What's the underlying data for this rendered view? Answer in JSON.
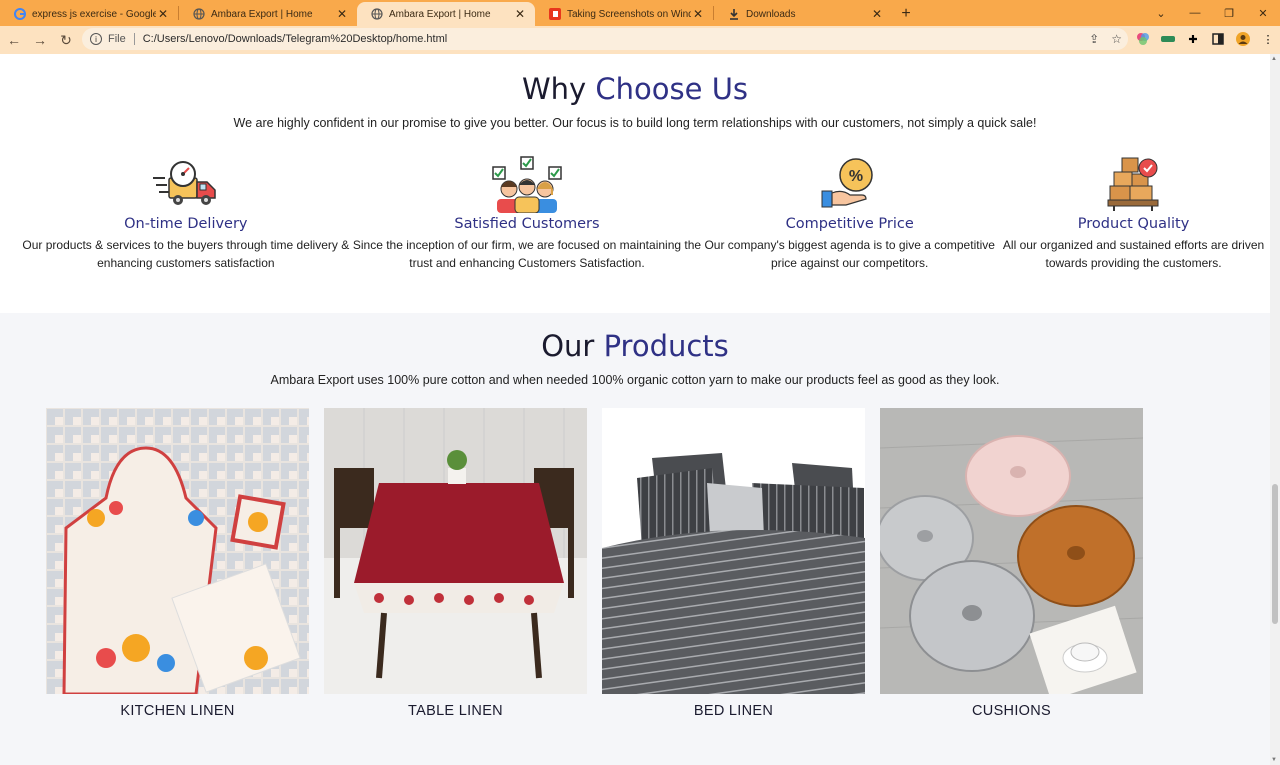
{
  "browser": {
    "tabs": [
      {
        "title": "express js exercise - Google Sear",
        "icon": "google-icon",
        "active": false
      },
      {
        "title": "Ambara Export | Home",
        "icon": "globe-icon",
        "active": false
      },
      {
        "title": "Ambara Export | Home",
        "icon": "globe-icon",
        "active": true
      },
      {
        "title": "Taking Screenshots on Windows",
        "icon": "snagit-icon",
        "active": false
      },
      {
        "title": "Downloads",
        "icon": "download-icon",
        "active": false
      }
    ],
    "address": {
      "scheme_label": "File",
      "url": "C:/Users/Lenovo/Downloads/Telegram%20Desktop/home.html"
    },
    "colors": {
      "frame": "#f9a94b",
      "toolbar": "#fde2c0"
    }
  },
  "why": {
    "title_part1": "Why",
    "title_part2": "Choose Us",
    "subtitle": "We are highly confident in our promise to give you better. Our focus is to build long term relationships with our customers, not simply a quick sale!",
    "features": [
      {
        "title": "On-time Delivery",
        "text": "Our products & services to the buyers through time delivery & enhancing customers satisfaction",
        "icon": "delivery-truck-icon"
      },
      {
        "title": "Satisfied Customers",
        "text": "Since the inception of our firm, we are focused on maintaining the trust and enhancing Customers Satisfaction.",
        "icon": "customers-group-icon"
      },
      {
        "title": "Competitive Price",
        "text": "Our company's biggest agenda is to give a competitive price against our competitors.",
        "icon": "price-hand-icon"
      },
      {
        "title": "Product Quality",
        "text": "All our organized and sustained efforts are driven towards providing the customers.",
        "icon": "quality-boxes-icon"
      }
    ]
  },
  "products": {
    "title_part1": "Our",
    "title_part2": "Products",
    "subtitle": "Ambara Export uses 100% pure cotton and when needed 100% organic cotton yarn to make our products feel as good as they look.",
    "items": [
      {
        "label": "KITCHEN LINEN"
      },
      {
        "label": "TABLE LINEN"
      },
      {
        "label": "BED LINEN"
      },
      {
        "label": "CUSHIONS"
      }
    ]
  },
  "colors": {
    "accent": "#2f3185",
    "heading": "#1b1b2f",
    "products_bg": "#f5f6f9"
  }
}
